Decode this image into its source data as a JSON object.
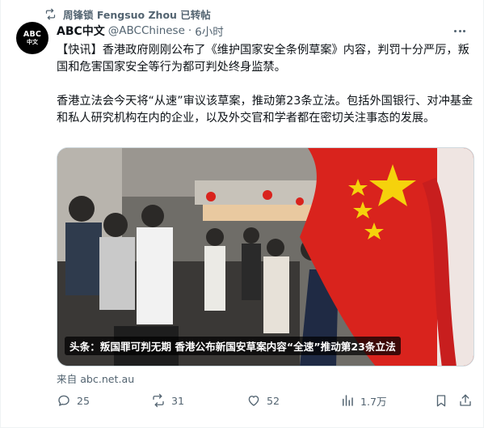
{
  "repost": {
    "label": "周锋锁 Fengsuo Zhou 已转帖"
  },
  "author": {
    "avatar_line1": "ABC",
    "avatar_line2": "中文",
    "name": "ABC中文",
    "handle": "@ABCChinese",
    "separator": "·",
    "time": "6小时"
  },
  "post": {
    "paragraph1": "【快讯】香港政府刚刚公布了《维护国家安全条例草案》内容，判罚十分严厉，叛国和危害国家安全等行为都可判处终身监禁。",
    "paragraph2": "香港立法会今天将“从速”审议该草案，推动第23条立法。包括外国银行、对冲基金和私人研究机构在内的企业，以及外交官和学者都在密切关注事态的发展。"
  },
  "card": {
    "caption": "头条：叛国罪可判无期 香港公布新国安草案内容“全速”推动第23条立法",
    "source": "来自 abc.net.au"
  },
  "metrics": {
    "replies": "25",
    "reposts": "31",
    "likes": "52",
    "views": "1.7万"
  },
  "colors": {
    "muted": "#536471",
    "text": "#0f1419",
    "flag_red": "#d9231d",
    "flag_star": "#f5d20c"
  },
  "icons": [
    "repost-icon",
    "more-icon",
    "reply-icon",
    "like-icon",
    "views-icon",
    "bookmark-icon",
    "share-icon"
  ]
}
